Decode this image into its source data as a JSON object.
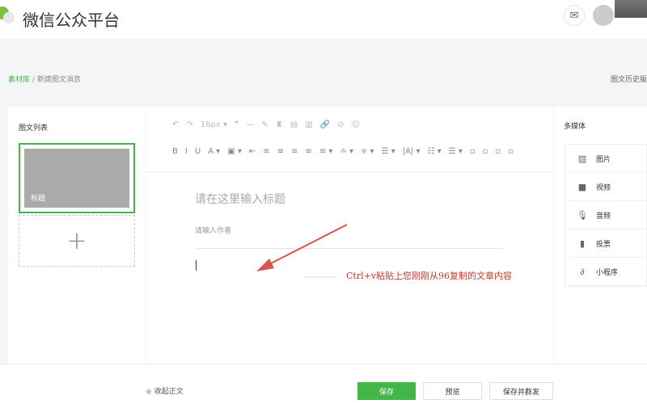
{
  "header": {
    "title": "微信公众平台",
    "mail_icon": "mail-icon",
    "avatar_icon": "user-avatar"
  },
  "breadcrumb": {
    "root": "素材库",
    "sep": "/",
    "current": "新建图文消息"
  },
  "history_link": "图文历史版",
  "left_panel": {
    "heading": "图文列表",
    "card_title": "标题",
    "add_label": "+"
  },
  "toolbar": {
    "row1": [
      "↶",
      "↷",
      "16px ▾",
      "❞",
      "—",
      "✎",
      "♜",
      "▤",
      "▥",
      "🔗",
      "⊘",
      "☺"
    ],
    "row2": [
      "B",
      "I",
      "U",
      "A ▾",
      "▣ ▾",
      "⇤",
      "≡",
      "≡",
      "≡",
      "≡",
      "≡ ▾",
      "≐ ▾",
      "≑ ▾",
      "☰ ▾",
      "|A| ▾",
      "☷ ▾",
      "☰ ▾",
      "▫",
      "▫",
      "▫",
      "▫"
    ]
  },
  "editor": {
    "title_placeholder": "请在这里输入标题",
    "author_placeholder": "请输入作者",
    "annotation": "Ctrl+v粘贴上您刚刚从96复制的文章内容",
    "annotation_color": "#c0392b"
  },
  "media": {
    "heading": "多媒体",
    "items": [
      {
        "icon": "image-icon",
        "glyph": "▨",
        "label": "图片"
      },
      {
        "icon": "video-icon",
        "glyph": "■",
        "label": "视频"
      },
      {
        "icon": "microphone-icon",
        "glyph": "🎙",
        "label": "音频"
      },
      {
        "icon": "vote-icon",
        "glyph": "▮",
        "label": "投票"
      },
      {
        "icon": "mini-program-icon",
        "glyph": "∂",
        "label": "小程序"
      }
    ]
  },
  "footer": {
    "fold": "收起正文",
    "save": "保存",
    "preview": "预览",
    "save_send": "保存并群发"
  },
  "colors": {
    "accent": "#44b549"
  }
}
